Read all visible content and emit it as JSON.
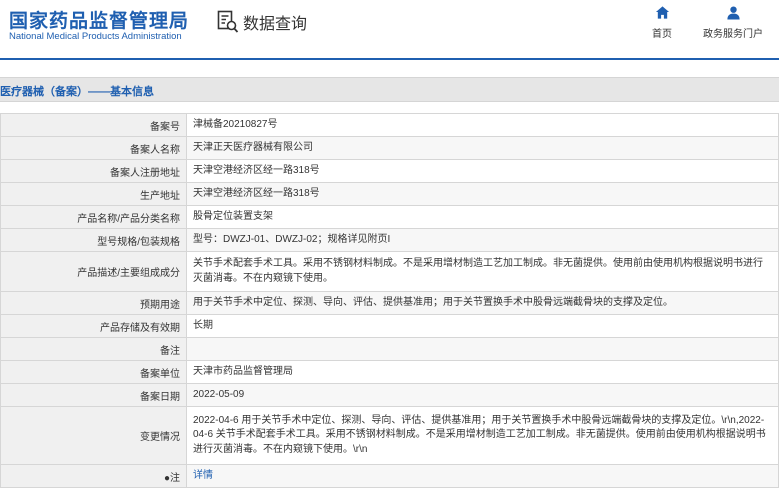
{
  "header": {
    "logo_cn": "国家药品监督管理局",
    "logo_en": "National Medical Products Administration",
    "page_title": "数据查询",
    "nav": [
      {
        "label": "首页",
        "icon": "home-icon"
      },
      {
        "label": "政务服务门户",
        "icon": "user-icon"
      }
    ]
  },
  "breadcrumb": "医疗器械（备案）——基本信息",
  "rows": [
    {
      "key": "备案号",
      "value": "津械备20210827号"
    },
    {
      "key": "备案人名称",
      "value": "天津正天医疗器械有限公司"
    },
    {
      "key": "备案人注册地址",
      "value": "天津空港经济区经一路318号"
    },
    {
      "key": "生产地址",
      "value": "天津空港经济区经一路318号"
    },
    {
      "key": "产品名称/产品分类名称",
      "value": "股骨定位装置支架"
    },
    {
      "key": "型号规格/包装规格",
      "value": "型号：DWZJ-01、DWZJ-02；规格详见附页I"
    },
    {
      "key": "产品描述/主要组成成分",
      "value": "关节手术配套手术工具。采用不锈钢材料制成。不是采用增材制造工艺加工制成。非无菌提供。使用前由使用机构根据说明书进行灭菌消毒。不在内窥镜下使用。"
    },
    {
      "key": "预期用途",
      "value": "用于关节手术中定位、探测、导向、评估、提供基准用；用于关节置换手术中股骨远端截骨块的支撑及定位。"
    },
    {
      "key": "产品存储及有效期",
      "value": "长期"
    },
    {
      "key": "备注",
      "value": ""
    },
    {
      "key": "备案单位",
      "value": "天津市药品监督管理局"
    },
    {
      "key": "备案日期",
      "value": "2022-05-09"
    },
    {
      "key": "变更情况",
      "value": "2022-04-6 用于关节手术中定位、探测、导向、评估、提供基准用；用于关节置换手术中股骨远端截骨块的支撑及定位。\\r\\n,2022-04-6 关节手术配套手术工具。采用不锈钢材料制成。不是采用增材制造工艺加工制成。非无菌提供。使用前由使用机构根据说明书进行灭菌消毒。不在内窥镜下使用。\\r\\n"
    },
    {
      "key": "●注",
      "value": "详情"
    }
  ],
  "colors": {
    "brand": "#1f5fb0",
    "key_bg": "#f0f0f0",
    "crumb_bg": "#e6e6e6"
  }
}
